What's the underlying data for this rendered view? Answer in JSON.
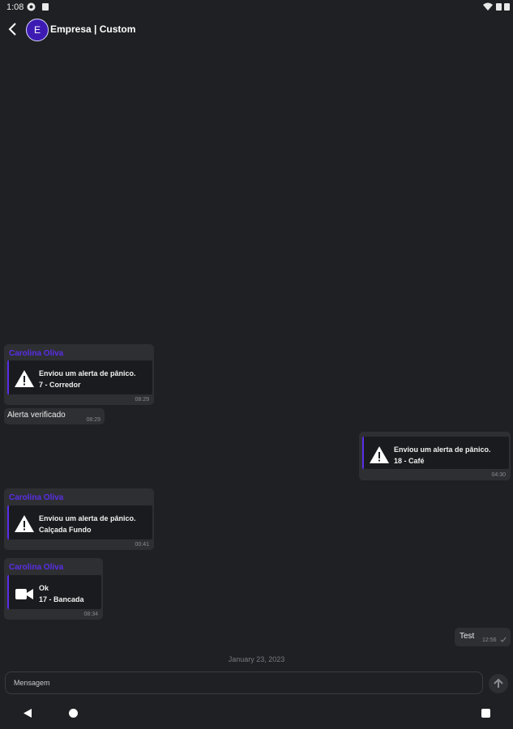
{
  "status": {
    "time": "1:08"
  },
  "header": {
    "avatar_initial": "E",
    "title": "Empresa | Custom"
  },
  "messages": [
    {
      "sender": "Carolina Oliva",
      "line1": "Enviou um alerta de pânico.",
      "line2": "7 - Corredor",
      "time": "08:29",
      "icon": "warning-icon"
    },
    {
      "text": "Alerta verificado",
      "time": "08:29"
    },
    {
      "line1": "Enviou um alerta de pânico.",
      "line2": "18 - Café",
      "time": "04:30",
      "icon": "warning-icon"
    },
    {
      "sender": "Carolina Oliva",
      "line1": "Enviou um alerta de pânico.",
      "line2": "Calçada Fundo",
      "time": "00:41",
      "icon": "warning-icon"
    },
    {
      "sender": "Carolina Oliva",
      "line1": "Ok",
      "line2": "17 - Bancada",
      "time": "08:34",
      "icon": "video-camera-icon"
    },
    {
      "text": "Test",
      "time": "12:56"
    }
  ],
  "date_separator": "January 23, 2023",
  "composer": {
    "placeholder": "Mensagem"
  },
  "colors": {
    "accent": "#5a2ee6",
    "background": "#1f2023",
    "bubble": "#2e2f33"
  }
}
